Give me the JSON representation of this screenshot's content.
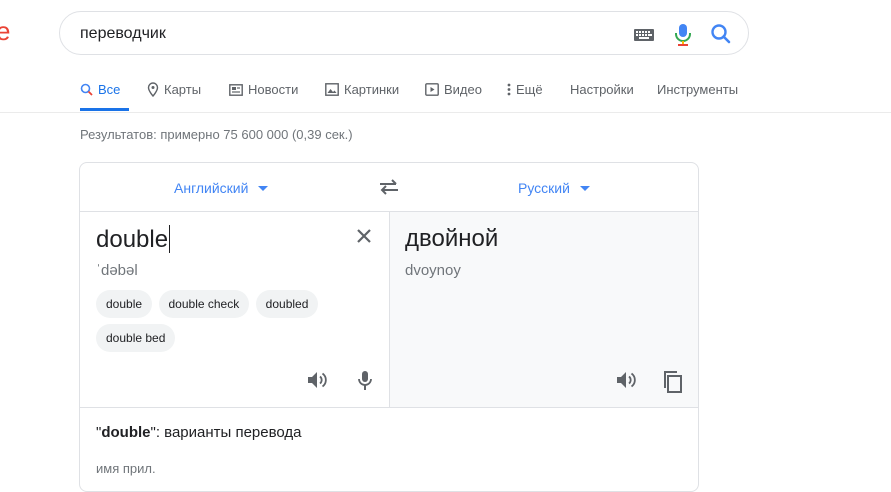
{
  "logo_fragment": "e",
  "search": {
    "query": "переводчик"
  },
  "tabs": [
    {
      "label": "Все",
      "icon": "search-icon"
    },
    {
      "label": "Карты",
      "icon": "map-pin-icon"
    },
    {
      "label": "Новости",
      "icon": "news-icon"
    },
    {
      "label": "Картинки",
      "icon": "image-icon"
    },
    {
      "label": "Видео",
      "icon": "video-icon"
    },
    {
      "label": "Ещё",
      "icon": "more-vert-icon"
    },
    {
      "label": "Настройки"
    },
    {
      "label": "Инструменты"
    }
  ],
  "result_stats": "Результатов: примерно 75 600 000 (0,39 сек.)",
  "translator": {
    "source_lang": "Английский",
    "target_lang": "Русский",
    "source_text": "double",
    "source_transliteration": "ˈdəbəl",
    "suggestions": [
      "double",
      "double check",
      "doubled",
      "double bed"
    ],
    "target_text": "двойной",
    "target_transliteration": "dvoynoy",
    "definitions_word": "double",
    "definitions_suffix": ": варианты перевода",
    "part_of_speech": "имя прил."
  },
  "colors": {
    "accent": "#1a73e8",
    "logo_red": "#EA4335"
  }
}
